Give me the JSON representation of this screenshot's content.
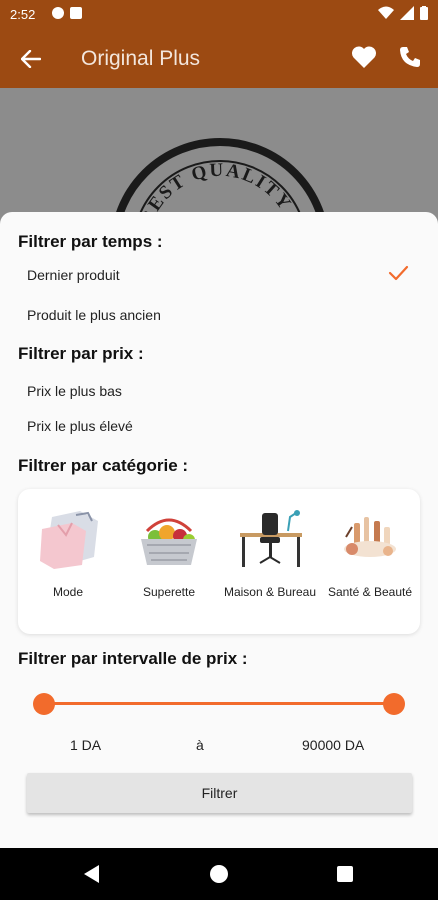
{
  "status_bar": {
    "time": "2:52"
  },
  "app_bar": {
    "title": "Original Plus"
  },
  "filters": {
    "time": {
      "title": "Filtrer par temps :",
      "options": [
        "Dernier produit",
        "Produit le plus ancien"
      ],
      "selected_index": 0
    },
    "price": {
      "title": "Filtrer par prix :",
      "options": [
        "Prix le plus bas",
        "Prix le plus élevé"
      ]
    },
    "category": {
      "title": "Filtrer par catégorie :",
      "items": [
        {
          "label": "Mode",
          "icon": "clothes-icon"
        },
        {
          "label": "Superette",
          "icon": "grocery-basket-icon"
        },
        {
          "label": "Maison & Bureau",
          "icon": "desk-chair-icon"
        },
        {
          "label": "Santé & Beauté",
          "icon": "cosmetics-icon"
        }
      ]
    },
    "range": {
      "title": "Filtrer par intervalle de prix :",
      "min_label": "1 DA",
      "separator": "à",
      "max_label": "90000 DA",
      "min_fraction": 0,
      "max_fraction": 1
    }
  },
  "filter_button": {
    "label": "Filtrer"
  },
  "colors": {
    "accent": "#f26b2c",
    "app_bar": "#9c4a12"
  }
}
